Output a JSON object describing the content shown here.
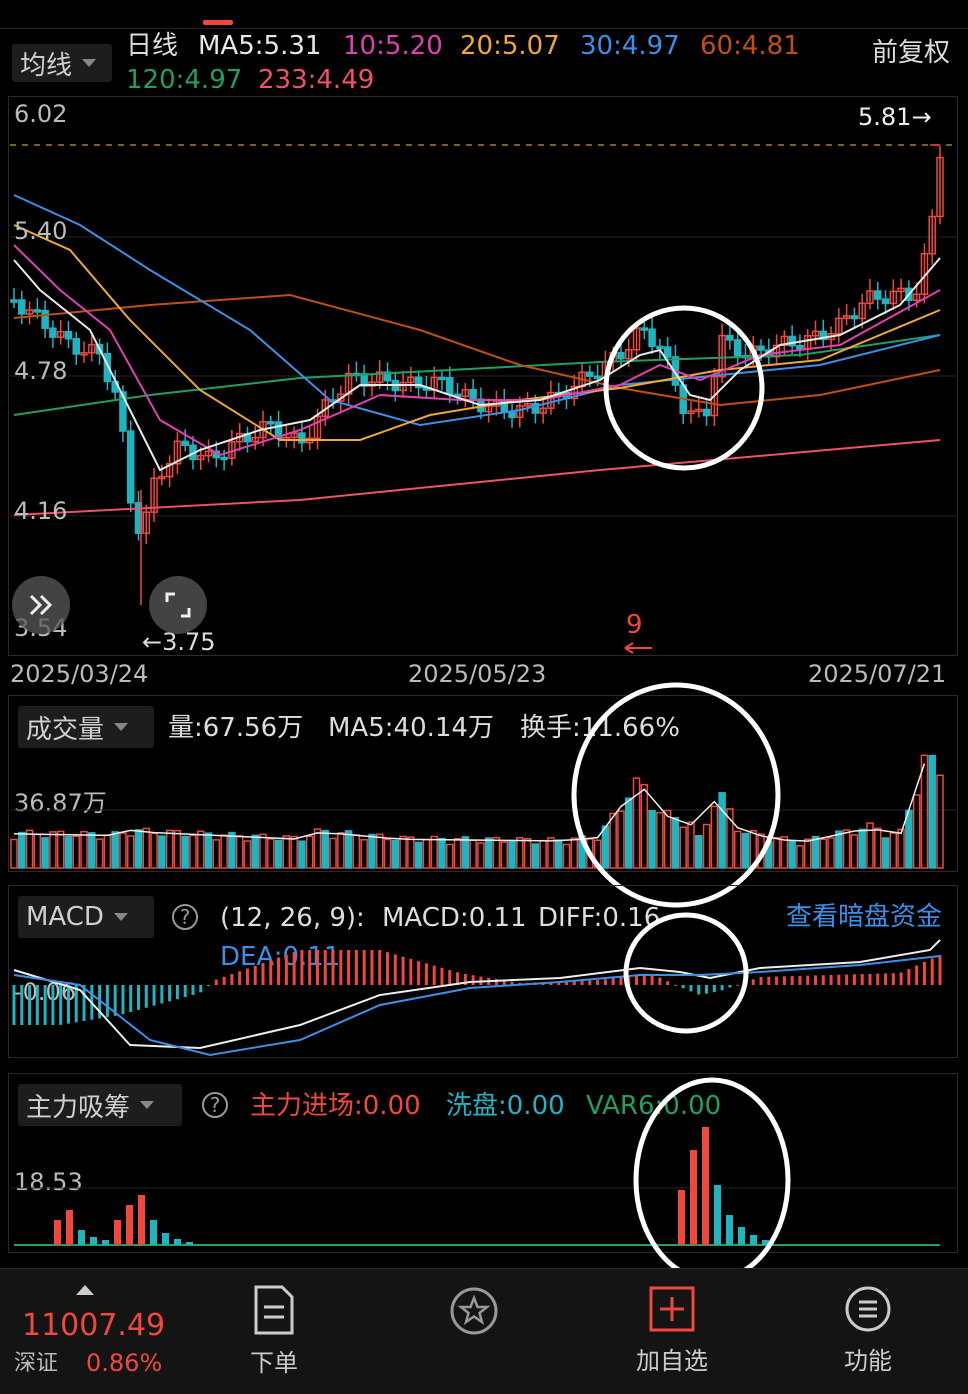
{
  "header": {
    "ma_dropdown": "均线",
    "period": "日线",
    "ma5": "MA5:5.31",
    "ma10": "10:5.20",
    "ma20": "20:5.07",
    "ma30": "30:4.97",
    "ma60": "60:4.81",
    "ma120": "120:4.97",
    "ma233": "233:4.49",
    "adjust": "前复权"
  },
  "colors": {
    "up": "#f0483c",
    "down": "#1fb4c0",
    "ma5": "#e8e8e8",
    "ma10": "#e040b0",
    "ma20": "#f0a830",
    "ma30": "#3a90e8",
    "ma60": "#c05010",
    "ma120": "#20a060",
    "ma233": "#f05068"
  },
  "price_chart": {
    "price_levels": [
      "6.02",
      "5.40",
      "4.78",
      "4.16",
      "3.54"
    ],
    "last_price_tag": "5.81→",
    "low_tag": "←3.75",
    "annotation": "9",
    "dates": [
      "2025/03/24",
      "2025/05/23",
      "2025/07/21"
    ],
    "expand_icon": "double-chevron-icon",
    "fullscreen_icon": "fullscreen-icon"
  },
  "volume_panel": {
    "dropdown": "成交量",
    "volume": "量:67.56万",
    "ma5": "MA5:40.14万",
    "turnover": "换手:11.66%",
    "axis_label": "36.87万"
  },
  "macd_panel": {
    "dropdown": "MACD",
    "params": "(12, 26, 9):",
    "macd": "MACD:0.11",
    "diff": "DIFF:0.16",
    "dea": "DEA:0.11",
    "link": "查看暗盘资金",
    "axis_label": "-0.06"
  },
  "fund_panel": {
    "dropdown": "主力吸筹",
    "main_in": "主力进场:0.00",
    "wash": "洗盘:0.00",
    "var6": "VAR6:0.00",
    "axis_label": "18.53"
  },
  "bottom_nav": {
    "index_value": "11007.49",
    "index_name": "深证",
    "index_change": "0.86%",
    "items": [
      {
        "label": "下单",
        "icon": "order-doc-icon"
      },
      {
        "label": "",
        "icon": "star-badge-icon"
      },
      {
        "label": "加自选",
        "icon": "add-watchlist-icon"
      },
      {
        "label": "功能",
        "icon": "menu-icon"
      }
    ]
  }
}
